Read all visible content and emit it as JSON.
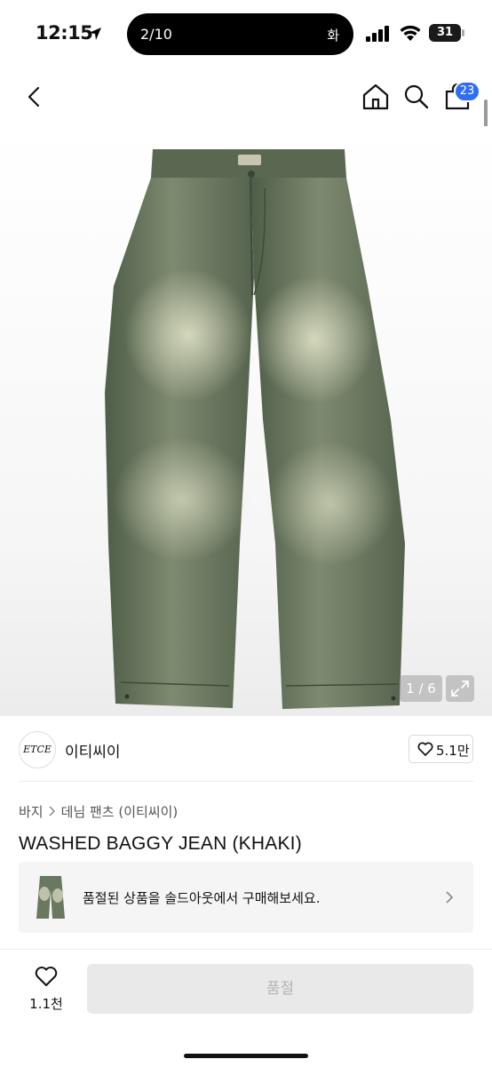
{
  "status_bar": {
    "time": "12:15",
    "island_counter": "2/10",
    "island_day": "화",
    "battery": "31"
  },
  "header": {
    "cart_badge": "23",
    "icons": [
      "back-chevron-icon",
      "home-icon",
      "search-icon",
      "shopping-bag-icon"
    ]
  },
  "gallery": {
    "counter": "1 / 6",
    "icons": [
      "expand-icon"
    ]
  },
  "brand": {
    "logo_text": "ETCE",
    "name": "이티씨이",
    "likes": "5.1만"
  },
  "breadcrumb": {
    "items": [
      "바지",
      "데님 팬츠 (이티씨이)"
    ]
  },
  "product": {
    "title": "WASHED BAGGY JEAN (KHAKI)",
    "soldout_message": "품절된 상품을 솔드아웃에서 구매해보세요."
  },
  "bottom_bar": {
    "wish_count": "1.1천",
    "buy_label": "품절"
  },
  "colors": {
    "badge": "#2f6df6",
    "denim": "#5b6b55",
    "button_disabled": "#e9e9e9"
  }
}
